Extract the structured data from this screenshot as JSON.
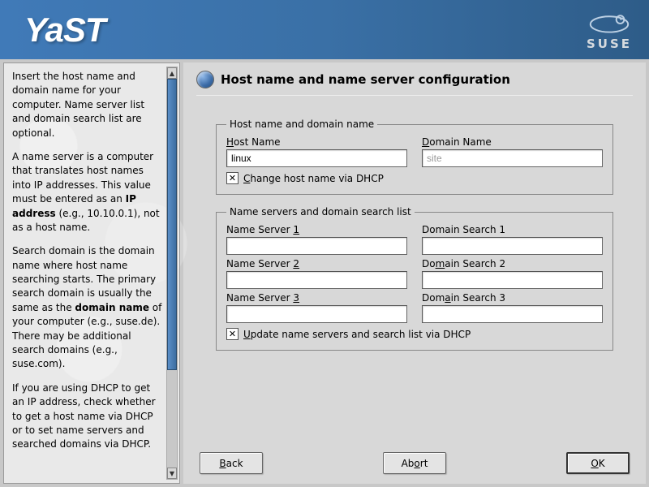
{
  "header": {
    "brand": "YaST",
    "distro": "SUSE"
  },
  "help": {
    "p1": "Insert the host name and domain name for your computer. Name server list and domain search list are optional.",
    "p2a": "A name server is a computer that translates host names into IP addresses. This value must be entered as an ",
    "p2b": "IP address",
    "p2c": " (e.g., 10.10.0.1), not as a host name.",
    "p3a": "Search domain is the domain name where host name searching starts. The primary search domain is usually the same as the ",
    "p3b": "domain name",
    "p3c": " of your computer (e.g., suse.de). There may be additional search domains (e.g., suse.com).",
    "p4": "If you are using DHCP to get an IP address, check whether to get a host name via DHCP or to set name servers and searched domains via DHCP."
  },
  "page": {
    "title": "Host name and name server configuration"
  },
  "fs_host": {
    "legend": "Host name and domain name",
    "host_label": "Host Name",
    "host_value": "linux",
    "domain_label": "Domain Name",
    "domain_value": "site",
    "chk_label": "Change host name via DHCP",
    "chk_checked": true
  },
  "fs_ns": {
    "legend": "Name servers and domain search list",
    "ns1_label": "Name Server 1",
    "ns2_label": "Name Server 2",
    "ns3_label": "Name Server 3",
    "ds1_label": "Domain Search 1",
    "ds2_label": "Domain Search 2",
    "ds3_label": "Domain Search 3",
    "ns1": "",
    "ns2": "",
    "ns3": "",
    "ds1": "",
    "ds2": "",
    "ds3": "",
    "chk_label": "Update name servers and search list via DHCP",
    "chk_checked": true
  },
  "buttons": {
    "back": "Back",
    "abort": "Abort",
    "ok": "OK"
  }
}
